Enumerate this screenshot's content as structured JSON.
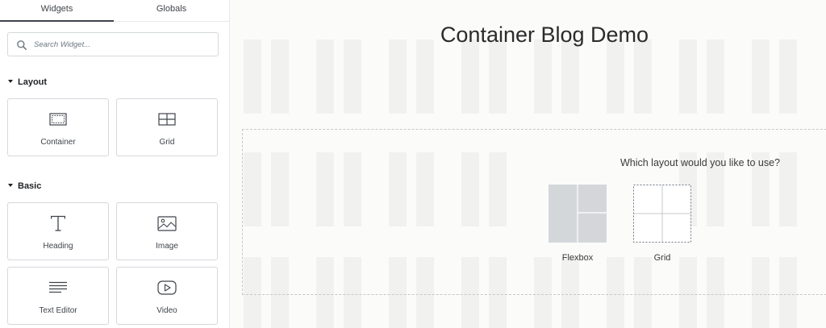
{
  "sidebar": {
    "tabs": [
      {
        "label": "Widgets",
        "active": true
      },
      {
        "label": "Globals",
        "active": false
      }
    ],
    "search": {
      "placeholder": "Search Widget..."
    },
    "categories": [
      {
        "label": "Layout",
        "widgets": [
          {
            "label": "Container",
            "icon": "container-icon"
          },
          {
            "label": "Grid",
            "icon": "grid-icon"
          }
        ]
      },
      {
        "label": "Basic",
        "widgets": [
          {
            "label": "Heading",
            "icon": "heading-icon"
          },
          {
            "label": "Image",
            "icon": "image-icon"
          },
          {
            "label": "Text Editor",
            "icon": "text-editor-icon"
          },
          {
            "label": "Video",
            "icon": "video-icon"
          }
        ]
      }
    ]
  },
  "canvas": {
    "page_title": "Container Blog Demo",
    "layout_prompt": {
      "question": "Which layout would you like to use?",
      "options": [
        {
          "label": "Flexbox",
          "icon": "flexbox-layout-icon"
        },
        {
          "label": "Grid",
          "icon": "grid-layout-icon"
        }
      ]
    }
  },
  "colors": {
    "text_dark": "#1f2124",
    "text_mid": "#3f444b",
    "border": "#d5d8dc",
    "canvas_bg": "#fbfbfa",
    "flexbox_fill": "#d4d7d9"
  }
}
